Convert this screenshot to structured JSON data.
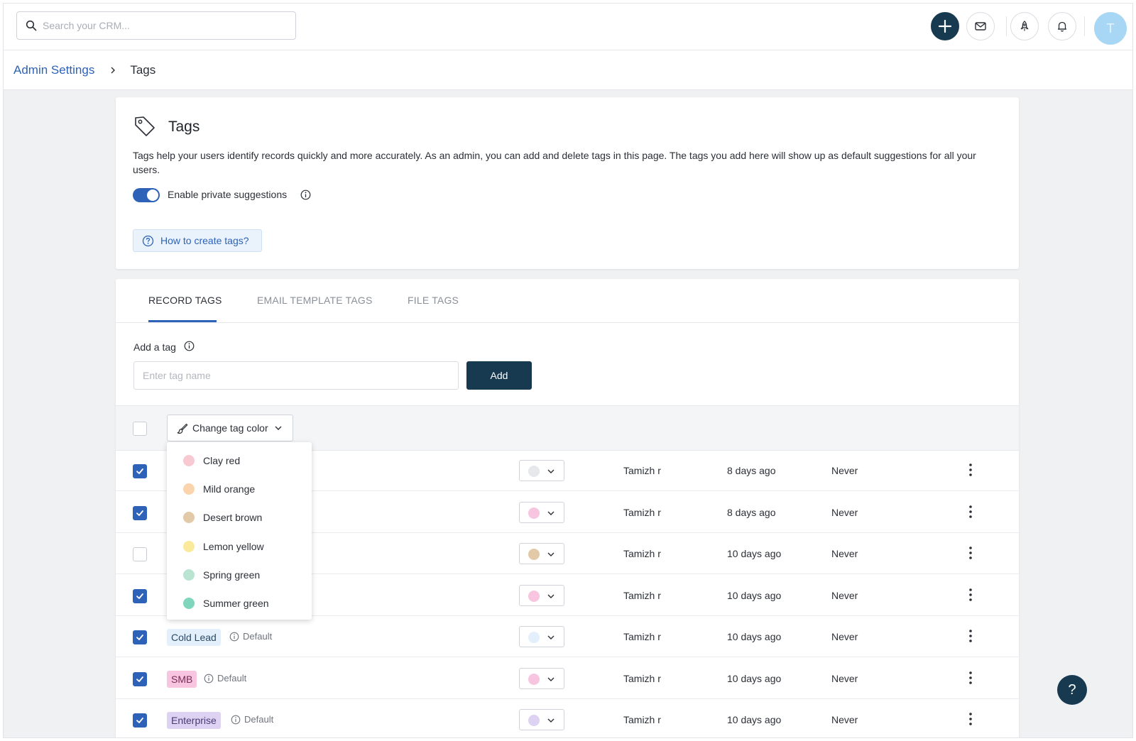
{
  "search": {
    "placeholder": "Search your CRM..."
  },
  "avatar": {
    "initial": "T",
    "color": "#a8d7f5"
  },
  "breadcrumb": {
    "parent": "Admin Settings",
    "current": "Tags"
  },
  "header": {
    "title": "Tags",
    "description": "Tags help your users identify records quickly and more accurately. As an admin, you can add and delete tags in this page. The tags you add here will show up as default suggestions for all your users.",
    "toggle_label": "Enable private suggestions",
    "toggle_on": true,
    "help_link": "How to create tags?"
  },
  "tabs": [
    {
      "label": "RECORD TAGS",
      "active": true
    },
    {
      "label": "EMAIL TEMPLATE TAGS",
      "active": false
    },
    {
      "label": "FILE TAGS",
      "active": false
    }
  ],
  "add_tag": {
    "label": "Add a tag",
    "placeholder": "Enter tag name",
    "button": "Add"
  },
  "toolbar": {
    "change_color_label": "Change tag color"
  },
  "color_menu": [
    {
      "label": "Clay red",
      "color": "#f8c9d1"
    },
    {
      "label": "Mild orange",
      "color": "#fbd4ad"
    },
    {
      "label": "Desert brown",
      "color": "#e2c9a8"
    },
    {
      "label": "Lemon yellow",
      "color": "#fbea9c"
    },
    {
      "label": "Spring green",
      "color": "#b9e4d2"
    },
    {
      "label": "Summer green",
      "color": "#7fd6bd"
    }
  ],
  "rows": [
    {
      "checked": true,
      "tag": "",
      "default": "",
      "swatch": "#e6e8eb",
      "owner": "Tamizh r",
      "created": "8 days ago",
      "last_used": "Never"
    },
    {
      "checked": true,
      "tag": "",
      "default": "",
      "swatch": "#f7c5e0",
      "owner": "Tamizh r",
      "created": "8 days ago",
      "last_used": "Never"
    },
    {
      "checked": false,
      "tag": "",
      "default": "",
      "swatch": "#e2c9a8",
      "owner": "Tamizh r",
      "created": "10 days ago",
      "last_used": "Never"
    },
    {
      "checked": true,
      "tag": "",
      "default": "",
      "swatch": "#f7c5e0",
      "owner": "Tamizh r",
      "created": "10 days ago",
      "last_used": "Never"
    },
    {
      "checked": true,
      "tag": "Cold Lead",
      "default": "Default",
      "chip_bg": "#e3f0fb",
      "chip_fg": "#2b4a66",
      "swatch": "#e3f0fb",
      "owner": "Tamizh r",
      "created": "10 days ago",
      "last_used": "Never"
    },
    {
      "checked": true,
      "tag": "SMB",
      "default": "Default",
      "chip_bg": "#f7c5e0",
      "chip_fg": "#7a2d57",
      "swatch": "#f7c5e0",
      "owner": "Tamizh r",
      "created": "10 days ago",
      "last_used": "Never"
    },
    {
      "checked": true,
      "tag": "Enterprise",
      "default": "Default",
      "chip_bg": "#ddd2f2",
      "chip_fg": "#4b3a75",
      "swatch": "#ddd2f2",
      "owner": "Tamizh r",
      "created": "10 days ago",
      "last_used": "Never"
    }
  ],
  "help_fab": {
    "label": "?"
  }
}
